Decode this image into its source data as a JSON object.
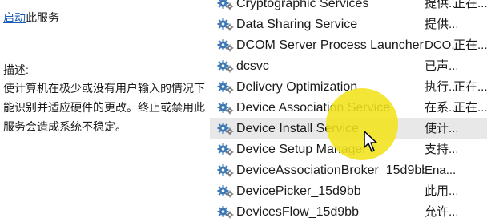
{
  "left_panel": {
    "start_link": "启动",
    "start_suffix": "此服务",
    "description_label": "描述:",
    "description_text": "使计算机在极少或没有用户输入的情况下能识别并适应硬件的更改。终止或禁用此服务会造成系统不稳定。"
  },
  "services": [
    {
      "name": "Cryptographic Services",
      "description": "提供...",
      "status": "正在..."
    },
    {
      "name": "Data Sharing Service",
      "description": "提供...",
      "status": ""
    },
    {
      "name": "DCOM Server Process Launcher",
      "description": "DCO...",
      "status": "正在..."
    },
    {
      "name": "dcsvc",
      "description": "已声...",
      "status": ""
    },
    {
      "name": "Delivery Optimization",
      "description": "执行...",
      "status": "正在..."
    },
    {
      "name": "Device Association Service",
      "description": "在系...",
      "status": "正在..."
    },
    {
      "name": "Device Install Service",
      "description": "使计...",
      "status": ""
    },
    {
      "name": "Device Setup Manager",
      "description": "支持...",
      "status": ""
    },
    {
      "name": "DeviceAssociationBroker_15d9bb",
      "description": "Ena...",
      "status": ""
    },
    {
      "name": "DevicePicker_15d9bb",
      "description": "此用...",
      "status": ""
    },
    {
      "name": "DevicesFlow_15d9bb",
      "description": "允许...",
      "status": ""
    }
  ],
  "selected_index": 6,
  "icons": {
    "service": "gear-icon",
    "pointer": "mouse-pointer-icon",
    "click_marker": "click-highlight"
  },
  "colors": {
    "link": "#1a5fb4",
    "selection": "#e8e8e8",
    "highlight": "#f3e21a"
  }
}
